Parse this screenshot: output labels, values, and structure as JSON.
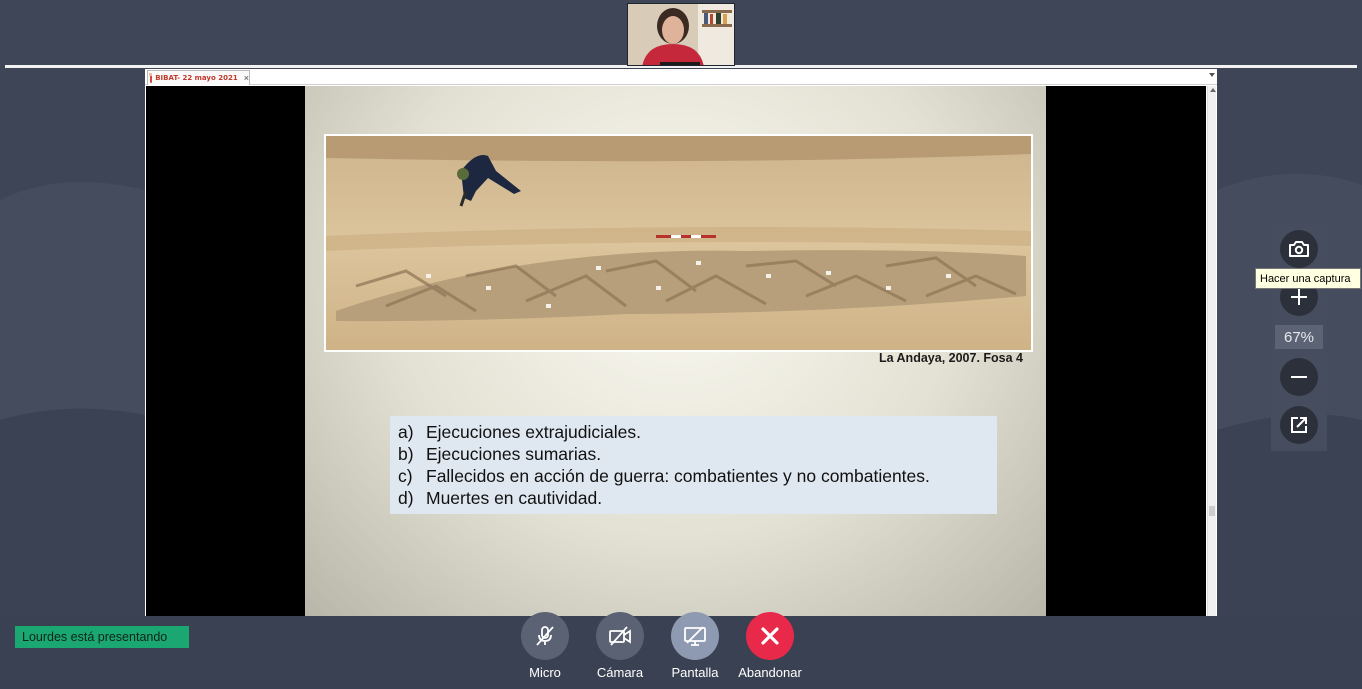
{
  "webcam": {
    "participant_icon": "participant-video"
  },
  "document": {
    "tab_label": "BIBAT- 22 mayo 2021",
    "tab_close": "×",
    "slide": {
      "photo_icon": "excavation-photo",
      "caption": "La Andaya, 2007. Fosa 4",
      "items": [
        {
          "letter": "a)",
          "text": "Ejecuciones extrajudiciales."
        },
        {
          "letter": "b)",
          "text": "Ejecuciones sumarias."
        },
        {
          "letter": "c)",
          "text": "Fallecidos en acción de guerra: combatientes y no combatientes."
        },
        {
          "letter": "d)",
          "text": "Muertes en cautividad."
        }
      ]
    }
  },
  "zoom_panel": {
    "zoom_level": "67%",
    "tooltip": "Hacer una captura"
  },
  "bottom": {
    "presenter_status": "Lourdes está presentando",
    "controls": {
      "micro": "Micro",
      "camara": "Cámara",
      "pantalla": "Pantalla",
      "abandonar": "Abandonar"
    }
  },
  "colors": {
    "presenter_badge": "#1aa772",
    "leave_button": "#e8294a",
    "control_button": "#5b6274",
    "screen_button": "#8e9ab1"
  }
}
